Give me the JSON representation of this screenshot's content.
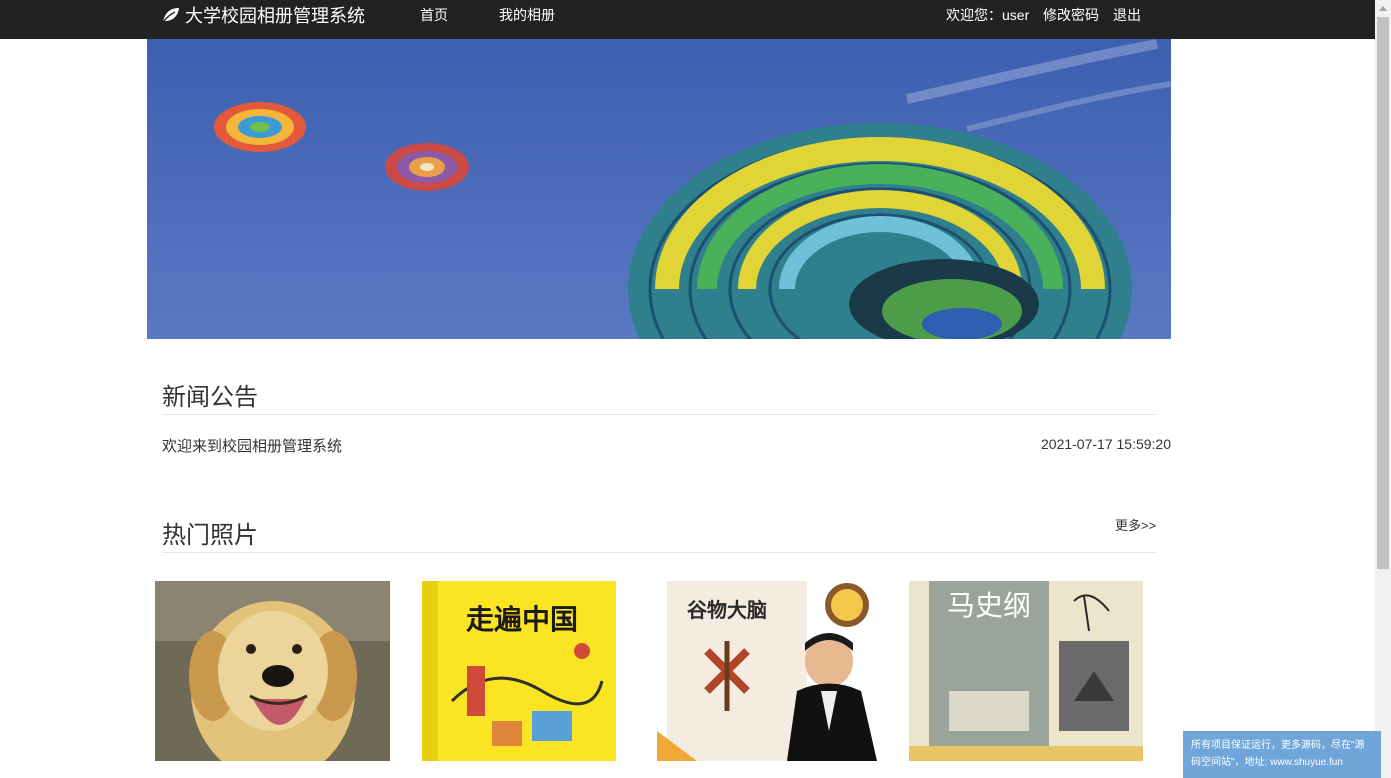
{
  "navbar": {
    "brand": "大学校园相册管理系统",
    "brand_icon": "leaf-icon",
    "links": [
      {
        "label": "首页"
      },
      {
        "label": "我的相册"
      }
    ],
    "welcome": "欢迎您：user",
    "change_password": "修改密码",
    "logout": "退出"
  },
  "banner": {
    "subject": "hot-air-balloons"
  },
  "news": {
    "title": "新闻公告",
    "items": [
      {
        "text": "欢迎来到校园相册管理系统",
        "date": "2021-07-17 15:59:20"
      }
    ]
  },
  "hot_photos": {
    "title": "热门照片",
    "more": "更多>>",
    "photos": [
      {
        "subject": "dog"
      },
      {
        "subject": "book-cover",
        "text": "走遍中国"
      },
      {
        "subject": "book-cover",
        "text": "谷物大脑"
      },
      {
        "subject": "book-cover",
        "text": "马史纲"
      }
    ]
  },
  "notice": {
    "text": "所有项目保证运行，更多源码，尽在\"源码空间站\"，地址: www.shuyue.fun"
  },
  "colors": {
    "navbar_bg": "#222222",
    "sky": "#4a6cb8",
    "notice_bg": "#6fa5d8"
  }
}
